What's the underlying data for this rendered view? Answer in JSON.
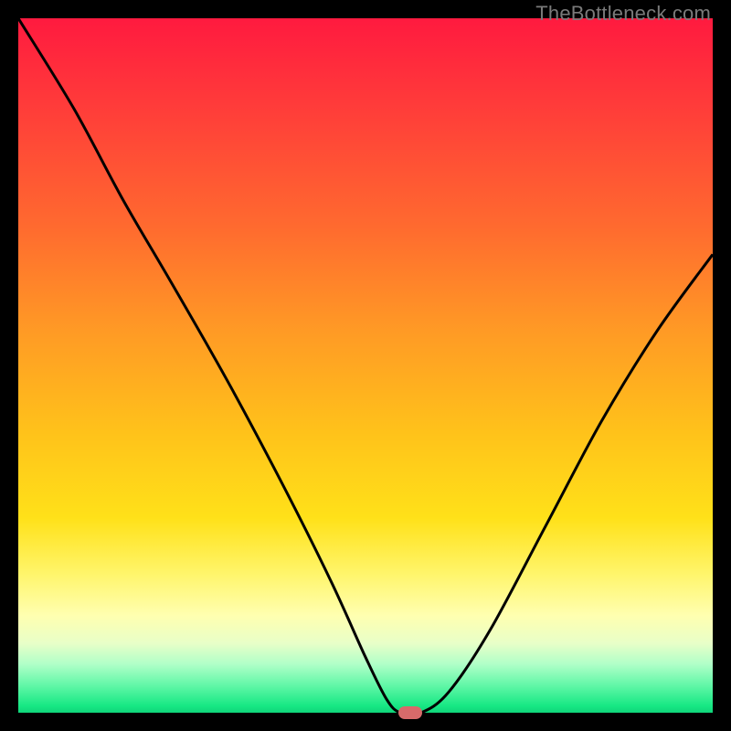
{
  "watermark": "TheBottleneck.com",
  "colors": {
    "curve": "#000000",
    "marker": "#d86a6a",
    "frame": "#000000"
  },
  "chart_data": {
    "type": "line",
    "title": "",
    "xlabel": "",
    "ylabel": "",
    "xlim": [
      0,
      100
    ],
    "ylim": [
      0,
      100
    ],
    "grid": false,
    "legend": false,
    "series": [
      {
        "name": "bottleneck-curve",
        "x": [
          0,
          8,
          15,
          22,
          30,
          38,
          45,
          50,
          53,
          55,
          58,
          62,
          68,
          76,
          84,
          92,
          100
        ],
        "values": [
          100,
          87,
          74,
          62,
          48,
          33,
          19,
          8,
          2,
          0,
          0,
          3,
          12,
          27,
          42,
          55,
          66
        ]
      }
    ],
    "marker": {
      "x": 56.5,
      "y": 0
    },
    "background_gradient": {
      "top": "#ff1a3f",
      "bottom": "#10d47a"
    }
  }
}
